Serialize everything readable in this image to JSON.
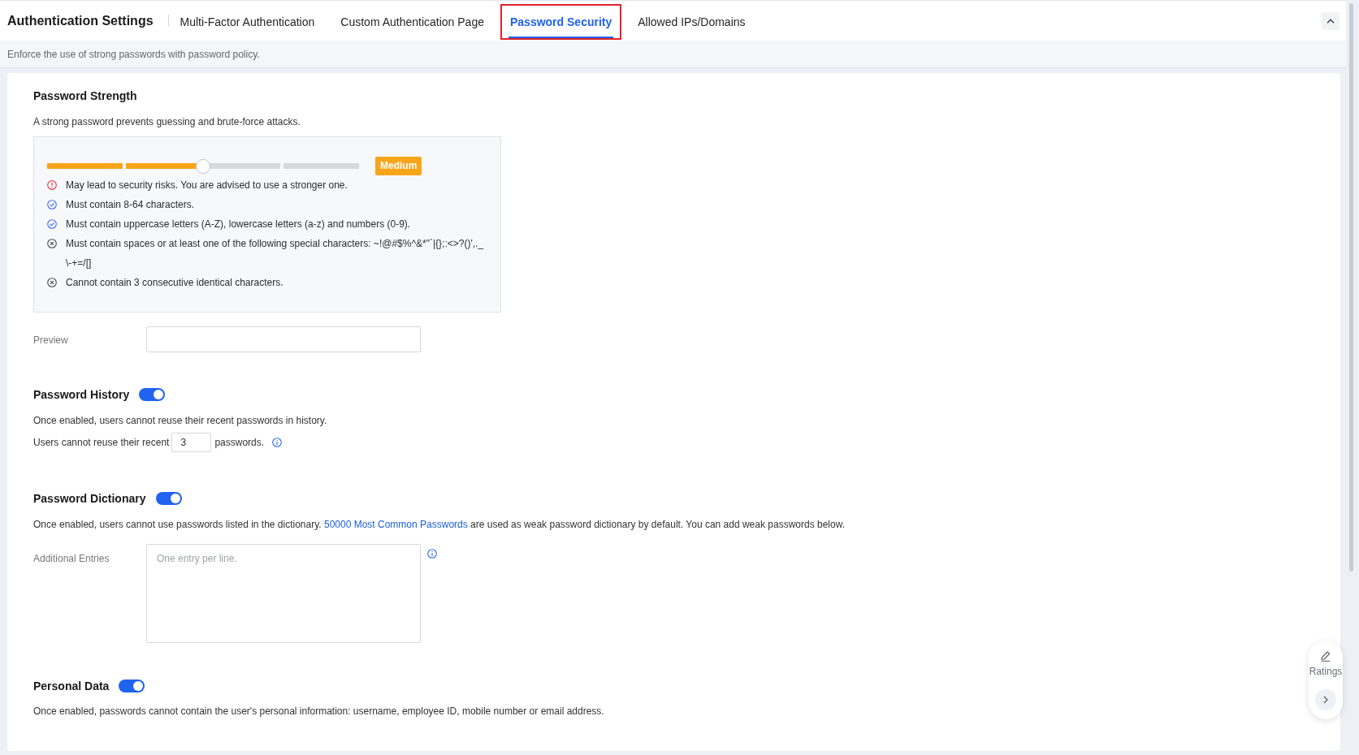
{
  "header": {
    "title": "Authentication Settings",
    "tabs": [
      {
        "label": "Multi-Factor Authentication",
        "selected": false,
        "highlighted": false
      },
      {
        "label": "Custom Authentication Page",
        "selected": false,
        "highlighted": false
      },
      {
        "label": "Password Security",
        "selected": true,
        "highlighted": true
      },
      {
        "label": "Allowed IPs/Domains",
        "selected": false,
        "highlighted": false
      }
    ]
  },
  "description": "Enforce the use of strong passwords with password policy.",
  "password_strength": {
    "title": "Password Strength",
    "description": "A strong password prevents guessing and brute-force attacks.",
    "meter": {
      "level": 0.5,
      "label": "Medium"
    },
    "rules": [
      {
        "kind": "warning",
        "text": "May lead to security risks. You are advised to use a stronger one."
      },
      {
        "kind": "passed",
        "text": "Must contain 8-64 characters."
      },
      {
        "kind": "passed",
        "text": "Must contain uppercase letters (A-Z), lowercase letters (a-z) and numbers (0-9)."
      },
      {
        "kind": "failed",
        "text": "Must contain spaces or at least one of the following special characters: ~!@#$%^&*\"`|{};:<>?()',._\\-+=/[]"
      },
      {
        "kind": "failed",
        "text": "Cannot contain 3 consecutive identical characters."
      }
    ],
    "preview": {
      "label": "Preview"
    }
  },
  "password_history": {
    "title": "Password History",
    "enabled": true,
    "description": "Once enabled, users cannot reuse their recent passwords in history.",
    "setting": {
      "text_before": "Users cannot reuse their recent",
      "value": "3",
      "text_after": "passwords."
    }
  },
  "password_dictionary": {
    "title": "Password Dictionary",
    "enabled": true,
    "description": {
      "text_before": "Once enabled, users cannot use passwords listed in the dictionary.",
      "link": "50000 Most Common Passwords",
      "text_after": "are used as weak password dictionary by default. You can add weak passwords below."
    },
    "entries": {
      "label": "Additional Entries",
      "placeholder": "One entry per line."
    }
  },
  "personal_data": {
    "title": "Personal Data",
    "enabled": true,
    "description": "Once enabled, passwords cannot contain the user's personal information: username, employee ID, mobile number or email address."
  },
  "ratings": {
    "label": "Ratings"
  }
}
